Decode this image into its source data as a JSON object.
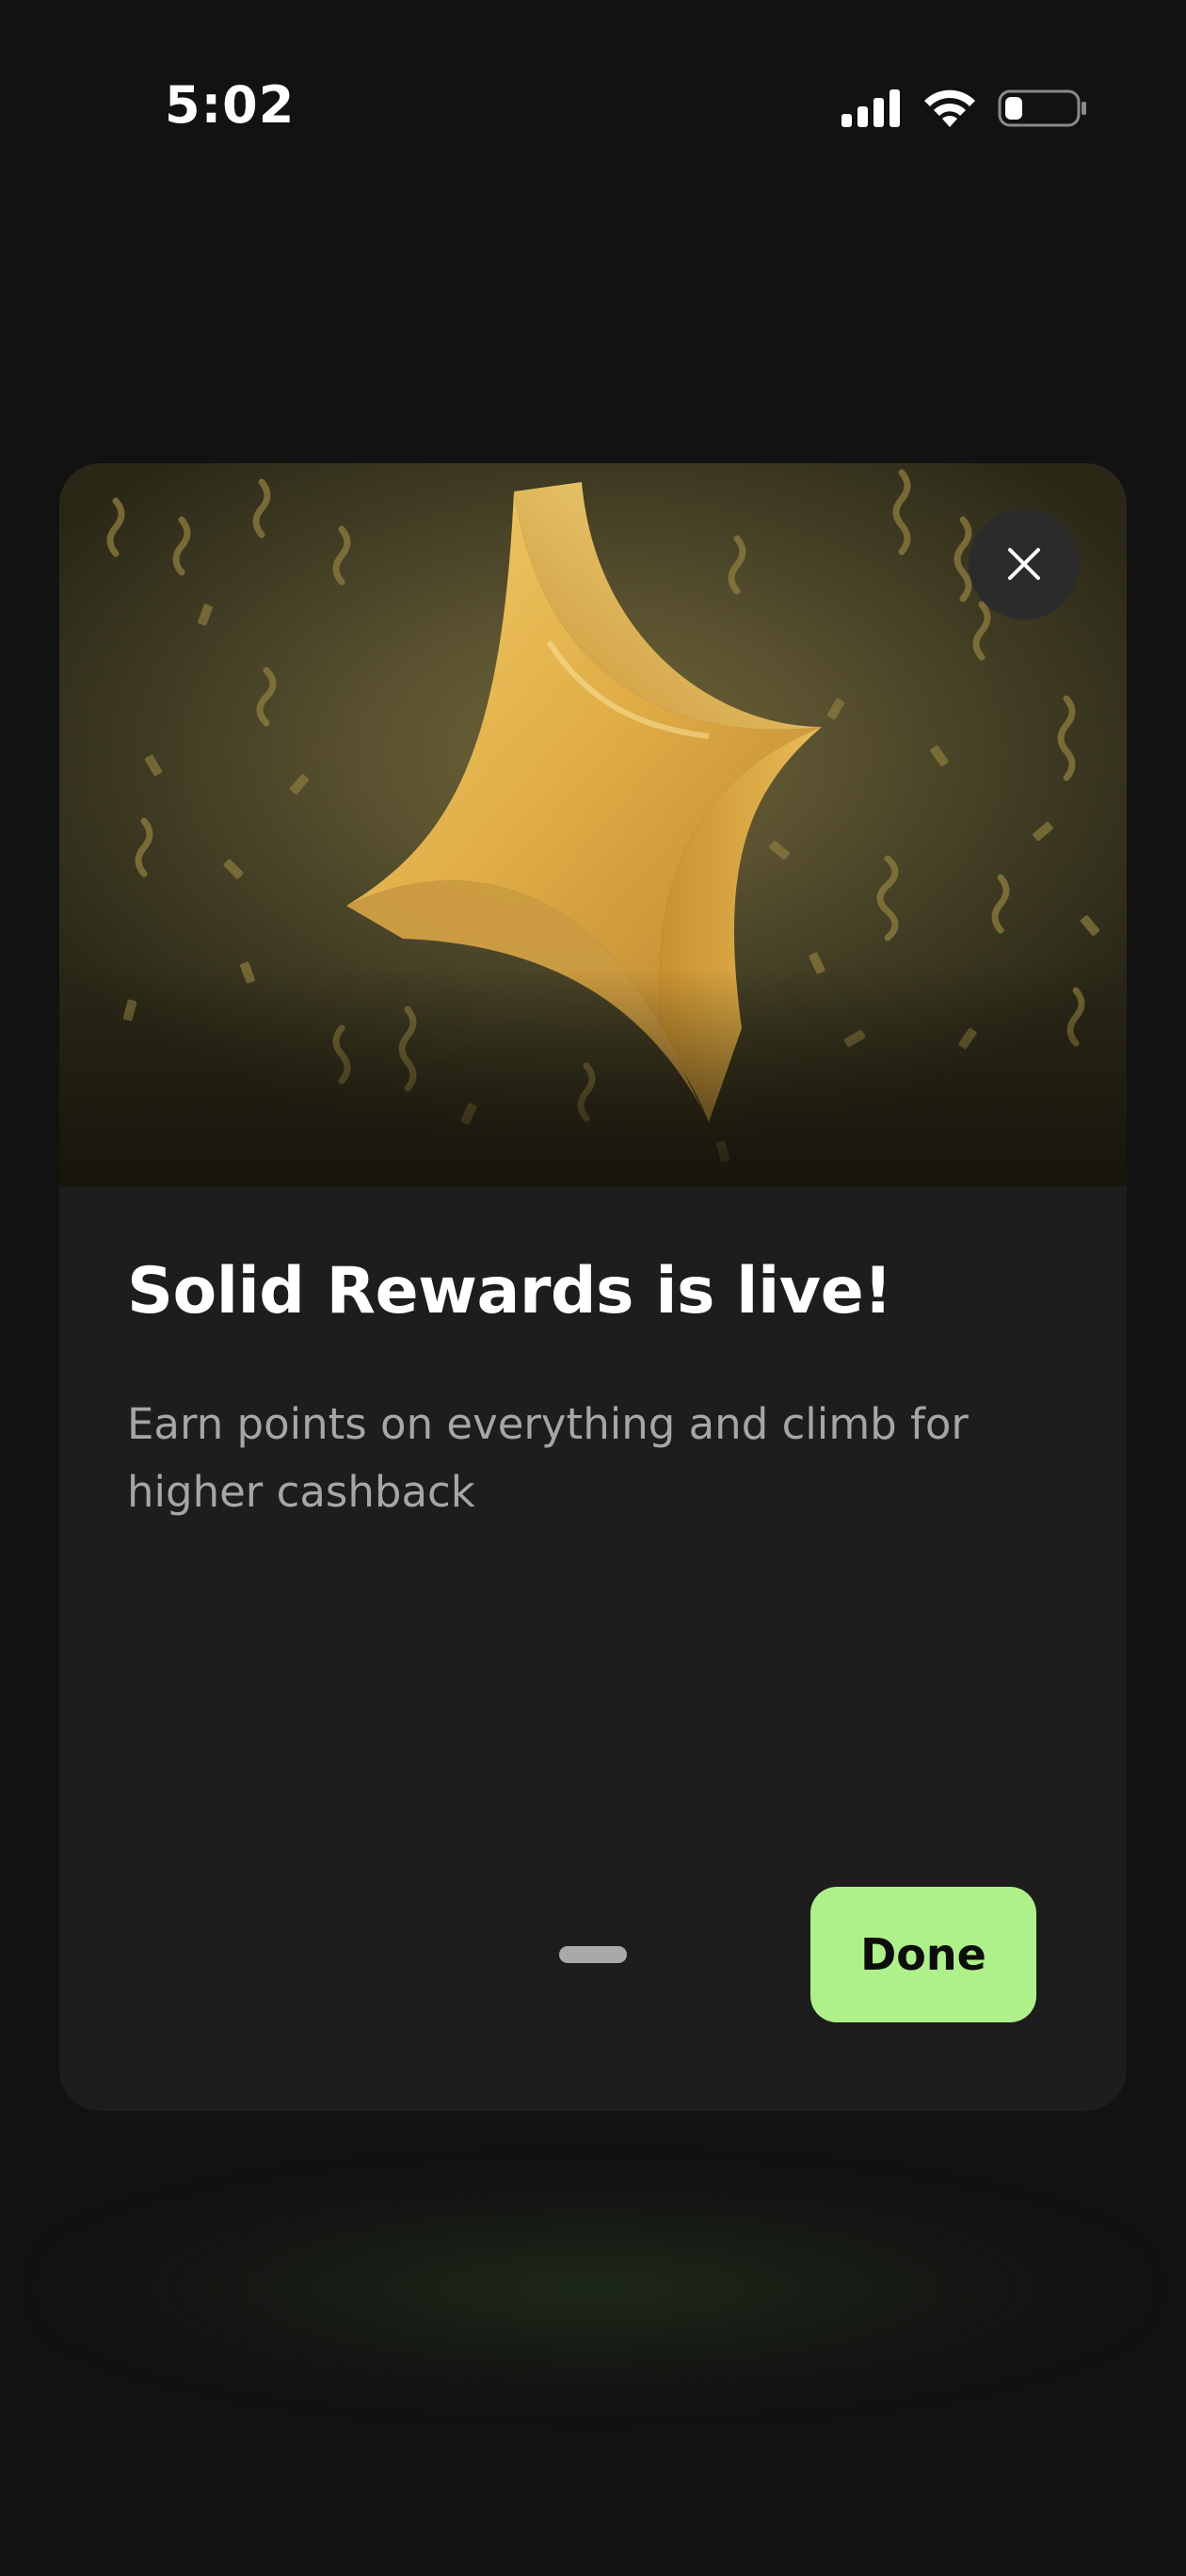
{
  "status_bar": {
    "time": "5:02",
    "icons": [
      "cellular-signal-icon",
      "wifi-icon",
      "battery-low-icon"
    ]
  },
  "modal": {
    "hero_image": "gold-four-point-star-with-confetti",
    "close_icon": "close-icon",
    "title": "Solid Rewards is live!",
    "description": "Earn points on everything and climb for higher cashback",
    "pagination": {
      "current_page": 1,
      "total_pages": 1
    },
    "primary_button_label": "Done"
  },
  "colors": {
    "background": "#121212",
    "card": "#1d1d1d",
    "accent_button": "#aef08a",
    "title_text": "#ffffff",
    "body_text": "#a6a6a6",
    "star_gold": "#e2b14c"
  }
}
